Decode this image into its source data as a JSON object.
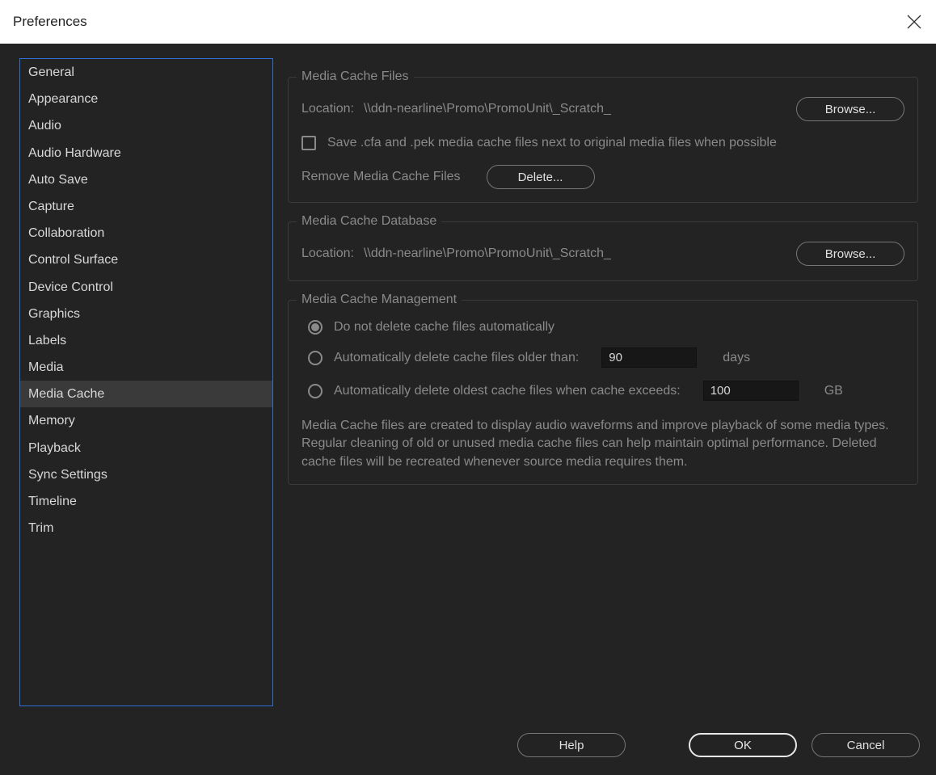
{
  "titlebar": {
    "title": "Preferences"
  },
  "sidebar": {
    "items": [
      {
        "label": "General",
        "selected": false
      },
      {
        "label": "Appearance",
        "selected": false
      },
      {
        "label": "Audio",
        "selected": false
      },
      {
        "label": "Audio Hardware",
        "selected": false
      },
      {
        "label": "Auto Save",
        "selected": false
      },
      {
        "label": "Capture",
        "selected": false
      },
      {
        "label": "Collaboration",
        "selected": false
      },
      {
        "label": "Control Surface",
        "selected": false
      },
      {
        "label": "Device Control",
        "selected": false
      },
      {
        "label": "Graphics",
        "selected": false
      },
      {
        "label": "Labels",
        "selected": false
      },
      {
        "label": "Media",
        "selected": false
      },
      {
        "label": "Media Cache",
        "selected": true
      },
      {
        "label": "Memory",
        "selected": false
      },
      {
        "label": "Playback",
        "selected": false
      },
      {
        "label": "Sync Settings",
        "selected": false
      },
      {
        "label": "Timeline",
        "selected": false
      },
      {
        "label": "Trim",
        "selected": false
      }
    ]
  },
  "groups": {
    "cacheFiles": {
      "legend": "Media Cache Files",
      "locationLabel": "Location:",
      "locationPath": "\\\\ddn-nearline\\Promo\\PromoUnit\\_Scratch_",
      "browse": "Browse...",
      "saveNext": "Save .cfa and .pek media cache files next to original media files when possible",
      "removeLabel": "Remove Media Cache Files",
      "delete": "Delete..."
    },
    "cacheDb": {
      "legend": "Media Cache Database",
      "locationLabel": "Location:",
      "locationPath": "\\\\ddn-nearline\\Promo\\PromoUnit\\_Scratch_",
      "browse": "Browse..."
    },
    "cacheMgmt": {
      "legend": "Media Cache Management",
      "opt1": "Do not delete cache files automatically",
      "opt2": "Automatically delete cache files older than:",
      "opt2Value": "90",
      "opt2Unit": "days",
      "opt3": "Automatically delete oldest cache files when cache exceeds:",
      "opt3Value": "100",
      "opt3Unit": "GB",
      "info": "Media Cache files are created to display audio waveforms and improve playback of some media types.  Regular cleaning of old or unused media cache files can help maintain optimal performance. Deleted cache files will be recreated whenever source media requires them."
    }
  },
  "footer": {
    "help": "Help",
    "ok": "OK",
    "cancel": "Cancel"
  }
}
